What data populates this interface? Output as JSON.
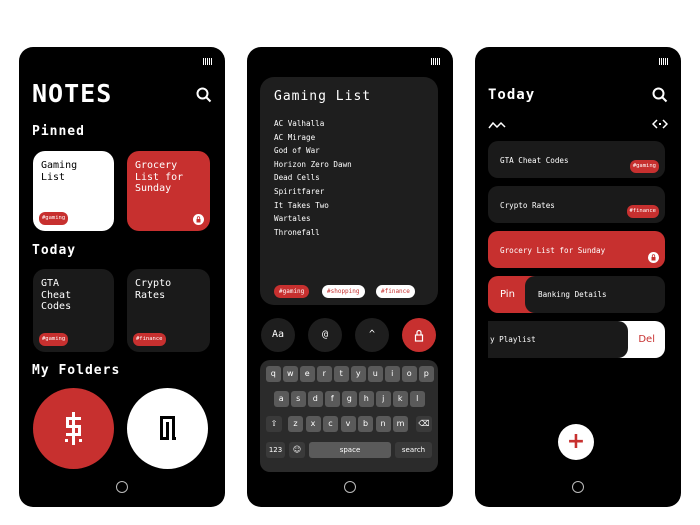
{
  "phone1": {
    "title": "NOTES",
    "pinned_heading": "Pinned",
    "pinned": [
      {
        "title": "Gaming List",
        "tag": "#gaming"
      },
      {
        "title": "Grocery List for Sunday"
      }
    ],
    "today_heading": "Today",
    "today": [
      {
        "title": "GTA Cheat Codes",
        "tag": "#gaming"
      },
      {
        "title": "Crypto Rates",
        "tag": "#finance"
      }
    ],
    "folders_heading": "My Folders"
  },
  "phone2": {
    "note_title": "Gaming List",
    "items": [
      "AC Valhalla",
      "AC Mirage",
      "God of War",
      "Horizon Zero Dawn",
      "Dead Cells",
      "Spiritfarer",
      "It Takes Two",
      "Wartales",
      "Thronefall"
    ],
    "tags": [
      "#gaming",
      "#shopping",
      "#finance"
    ],
    "toolbar": {
      "text_format": "Aa",
      "mention": "@",
      "up": "^"
    },
    "keyboard": {
      "row1": [
        "q",
        "w",
        "e",
        "r",
        "t",
        "y",
        "u",
        "i",
        "o",
        "p"
      ],
      "row2": [
        "a",
        "s",
        "d",
        "f",
        "g",
        "h",
        "j",
        "k",
        "l"
      ],
      "row3": [
        "z",
        "x",
        "c",
        "v",
        "b",
        "n",
        "m"
      ],
      "numbers": "123",
      "space": "space",
      "search": "search"
    }
  },
  "phone3": {
    "title": "Today",
    "list": [
      {
        "title": "GTA Cheat Codes",
        "tag": "#gaming"
      },
      {
        "title": "Crypto Rates",
        "tag": "#finance"
      },
      {
        "title": "Grocery List for Sunday"
      }
    ],
    "pin_label": "Pin",
    "pin_row_title": "Banking Details",
    "del_row_title": "y Playlist",
    "del_label": "Del",
    "fab": "+"
  },
  "colors": {
    "accent": "#c7302f",
    "background": "#000000",
    "card": "#1a1a1a"
  }
}
